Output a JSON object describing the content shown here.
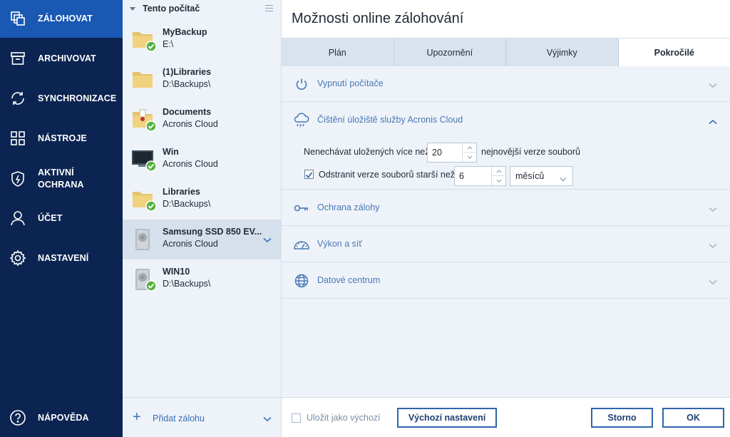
{
  "nav": {
    "items": [
      {
        "label": "ZÁLOHOVAT",
        "icon": "backup-icon"
      },
      {
        "label": "ARCHIVOVAT",
        "icon": "archive-icon"
      },
      {
        "label": "SYNCHRONIZACE",
        "icon": "sync-icon"
      },
      {
        "label": "NÁSTROJE",
        "icon": "tools-grid-icon"
      },
      {
        "label": "AKTIVNÍ OCHRANA",
        "icon": "shield-icon"
      },
      {
        "label": "ÚČET",
        "icon": "account-icon"
      },
      {
        "label": "NASTAVENÍ",
        "icon": "gear-icon"
      }
    ],
    "help_label": "NÁPOVĚDA",
    "active_color": "#1958b3",
    "background": "#0c2451"
  },
  "list": {
    "header": "Tento počítač",
    "items": [
      {
        "name": "MyBackup",
        "dest": "E:\\",
        "icon": "folder-icon",
        "status": "ok"
      },
      {
        "name": "(1)Libraries",
        "dest": "D:\\Backups\\",
        "icon": "folder-icon",
        "status": "none"
      },
      {
        "name": "Documents",
        "dest": "Acronis Cloud",
        "icon": "documents-folder-icon",
        "status": "ok"
      },
      {
        "name": "Win",
        "dest": "Acronis Cloud",
        "icon": "monitor-icon",
        "status": "ok"
      },
      {
        "name": "Libraries",
        "dest": "D:\\Backups\\",
        "icon": "folder-icon",
        "status": "ok"
      },
      {
        "name": "Samsung SSD 850 EV...",
        "dest": "Acronis Cloud",
        "icon": "drive-icon",
        "status": "none",
        "selected": true
      },
      {
        "name": "WIN10",
        "dest": "D:\\Backups\\",
        "icon": "drive-icon",
        "status": "ok"
      }
    ],
    "add_label": "Přidat zálohu"
  },
  "panel": {
    "title": "Možnosti online zálohování",
    "tabs": [
      {
        "label": "Plán"
      },
      {
        "label": "Upozornění"
      },
      {
        "label": "Výjimky"
      },
      {
        "label": "Pokročilé",
        "active": true
      }
    ],
    "sections": [
      {
        "label": "Vypnutí počítače",
        "icon": "power-icon",
        "expanded": false
      },
      {
        "label": "Čištění úložiště služby Acronis Cloud",
        "icon": "cloud-rain-icon",
        "expanded": true
      },
      {
        "label": "Ochrana zálohy",
        "icon": "key-icon",
        "expanded": false
      },
      {
        "label": "Výkon a síť",
        "icon": "speedometer-icon",
        "expanded": false
      },
      {
        "label": "Datové centrum",
        "icon": "globe-icon",
        "expanded": false
      }
    ],
    "cleanup": {
      "keep_label": "Nenechávat uložených více než:",
      "keep_value": "20",
      "keep_suffix": "nejnovější verze souborů",
      "delete_label": "Odstranit verze souborů starší než:",
      "delete_checked": true,
      "delete_value": "6",
      "delete_unit": "měsíců"
    },
    "footer": {
      "save_default_label": "Uložit jako výchozí",
      "save_default_checked": false,
      "reset_label": "Výchozí nastavení",
      "cancel_label": "Storno",
      "ok_label": "OK"
    }
  },
  "colors": {
    "accent": "#2e65ad",
    "link": "#4a77b4",
    "check_ok": "#52b33c"
  }
}
